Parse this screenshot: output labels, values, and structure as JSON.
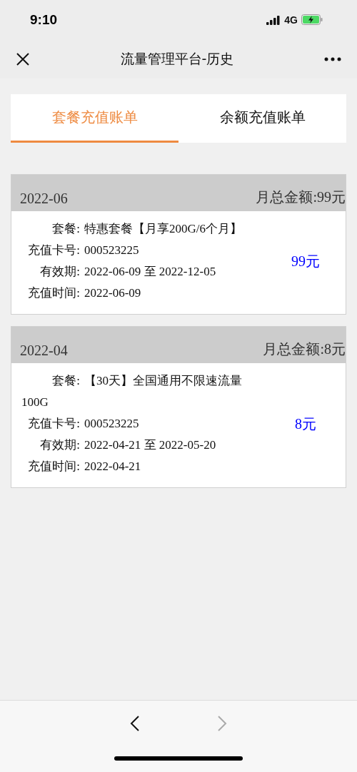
{
  "status_bar": {
    "time": "9:10",
    "network": "4G",
    "charging": true
  },
  "nav_bar": {
    "title": "流量管理平台-历史"
  },
  "tabs": [
    {
      "label": "套餐充值账单",
      "selected": true
    },
    {
      "label": "余额充值账单",
      "selected": false
    }
  ],
  "bills": [
    {
      "month": "2022-06",
      "total": "月总金额:99元",
      "amount": "99元",
      "fields": [
        {
          "label": "套餐:",
          "value": "特惠套餐【月享200G/6个月】"
        },
        {
          "label": "充值卡号:",
          "value": "000523225"
        },
        {
          "label": "有效期:",
          "value": "2022-06-09 至 2022-12-05"
        },
        {
          "label": "充值时间:",
          "value": "2022-06-09"
        }
      ]
    },
    {
      "month": "2022-04",
      "total": "月总金额:8元",
      "amount": "8元",
      "fields": [
        {
          "label": "套餐:",
          "value": "【30天】全国通用不限速流量100G"
        },
        {
          "label": "充值卡号:",
          "value": "000523225"
        },
        {
          "label": "有效期:",
          "value": "2022-04-21 至 2022-05-20"
        },
        {
          "label": "充值时间:",
          "value": "2022-04-21"
        }
      ]
    }
  ],
  "bottom_nav": {
    "back_disabled": false,
    "forward_disabled": true
  }
}
